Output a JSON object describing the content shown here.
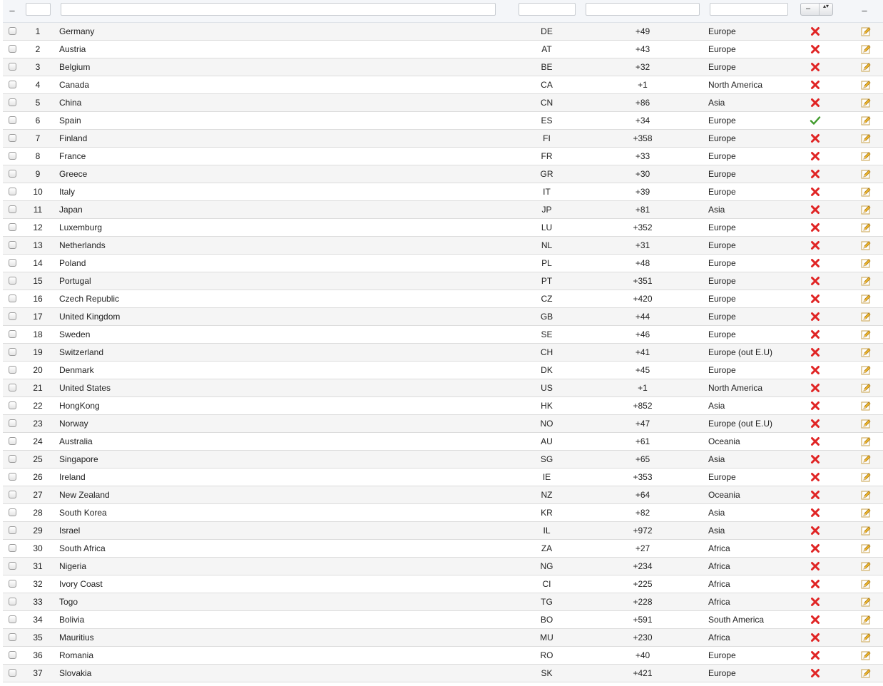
{
  "filters": {
    "select_dash": "–",
    "actions_dash": "–",
    "select_value": "–",
    "select_arrows": "▴▾",
    "id_placeholder": "",
    "name_placeholder": "",
    "code_placeholder": "",
    "prefix_placeholder": "",
    "region_placeholder": ""
  },
  "icons": {
    "inactive": "red-x-icon",
    "active": "green-check-icon",
    "edit": "pencil-icon"
  },
  "colors": {
    "inactive": "#e02424",
    "active": "#3f9a2a",
    "edit": "#e7a928",
    "row_alt": "#f5f5f5"
  },
  "rows": [
    {
      "id": "1",
      "name": "Germany",
      "code": "DE",
      "prefix": "+49",
      "region": "Europe",
      "active": false
    },
    {
      "id": "2",
      "name": "Austria",
      "code": "AT",
      "prefix": "+43",
      "region": "Europe",
      "active": false
    },
    {
      "id": "3",
      "name": "Belgium",
      "code": "BE",
      "prefix": "+32",
      "region": "Europe",
      "active": false
    },
    {
      "id": "4",
      "name": "Canada",
      "code": "CA",
      "prefix": "+1",
      "region": "North America",
      "active": false
    },
    {
      "id": "5",
      "name": "China",
      "code": "CN",
      "prefix": "+86",
      "region": "Asia",
      "active": false
    },
    {
      "id": "6",
      "name": "Spain",
      "code": "ES",
      "prefix": "+34",
      "region": "Europe",
      "active": true
    },
    {
      "id": "7",
      "name": "Finland",
      "code": "FI",
      "prefix": "+358",
      "region": "Europe",
      "active": false
    },
    {
      "id": "8",
      "name": "France",
      "code": "FR",
      "prefix": "+33",
      "region": "Europe",
      "active": false
    },
    {
      "id": "9",
      "name": "Greece",
      "code": "GR",
      "prefix": "+30",
      "region": "Europe",
      "active": false
    },
    {
      "id": "10",
      "name": "Italy",
      "code": "IT",
      "prefix": "+39",
      "region": "Europe",
      "active": false
    },
    {
      "id": "11",
      "name": "Japan",
      "code": "JP",
      "prefix": "+81",
      "region": "Asia",
      "active": false
    },
    {
      "id": "12",
      "name": "Luxemburg",
      "code": "LU",
      "prefix": "+352",
      "region": "Europe",
      "active": false
    },
    {
      "id": "13",
      "name": "Netherlands",
      "code": "NL",
      "prefix": "+31",
      "region": "Europe",
      "active": false
    },
    {
      "id": "14",
      "name": "Poland",
      "code": "PL",
      "prefix": "+48",
      "region": "Europe",
      "active": false
    },
    {
      "id": "15",
      "name": "Portugal",
      "code": "PT",
      "prefix": "+351",
      "region": "Europe",
      "active": false
    },
    {
      "id": "16",
      "name": "Czech Republic",
      "code": "CZ",
      "prefix": "+420",
      "region": "Europe",
      "active": false
    },
    {
      "id": "17",
      "name": "United Kingdom",
      "code": "GB",
      "prefix": "+44",
      "region": "Europe",
      "active": false
    },
    {
      "id": "18",
      "name": "Sweden",
      "code": "SE",
      "prefix": "+46",
      "region": "Europe",
      "active": false
    },
    {
      "id": "19",
      "name": "Switzerland",
      "code": "CH",
      "prefix": "+41",
      "region": "Europe (out E.U)",
      "active": false
    },
    {
      "id": "20",
      "name": "Denmark",
      "code": "DK",
      "prefix": "+45",
      "region": "Europe",
      "active": false
    },
    {
      "id": "21",
      "name": "United States",
      "code": "US",
      "prefix": "+1",
      "region": "North America",
      "active": false
    },
    {
      "id": "22",
      "name": "HongKong",
      "code": "HK",
      "prefix": "+852",
      "region": "Asia",
      "active": false
    },
    {
      "id": "23",
      "name": "Norway",
      "code": "NO",
      "prefix": "+47",
      "region": "Europe (out E.U)",
      "active": false
    },
    {
      "id": "24",
      "name": "Australia",
      "code": "AU",
      "prefix": "+61",
      "region": "Oceania",
      "active": false
    },
    {
      "id": "25",
      "name": "Singapore",
      "code": "SG",
      "prefix": "+65",
      "region": "Asia",
      "active": false
    },
    {
      "id": "26",
      "name": "Ireland",
      "code": "IE",
      "prefix": "+353",
      "region": "Europe",
      "active": false
    },
    {
      "id": "27",
      "name": "New Zealand",
      "code": "NZ",
      "prefix": "+64",
      "region": "Oceania",
      "active": false
    },
    {
      "id": "28",
      "name": "South Korea",
      "code": "KR",
      "prefix": "+82",
      "region": "Asia",
      "active": false
    },
    {
      "id": "29",
      "name": "Israel",
      "code": "IL",
      "prefix": "+972",
      "region": "Asia",
      "active": false
    },
    {
      "id": "30",
      "name": "South Africa",
      "code": "ZA",
      "prefix": "+27",
      "region": "Africa",
      "active": false
    },
    {
      "id": "31",
      "name": "Nigeria",
      "code": "NG",
      "prefix": "+234",
      "region": "Africa",
      "active": false
    },
    {
      "id": "32",
      "name": "Ivory Coast",
      "code": "CI",
      "prefix": "+225",
      "region": "Africa",
      "active": false
    },
    {
      "id": "33",
      "name": "Togo",
      "code": "TG",
      "prefix": "+228",
      "region": "Africa",
      "active": false
    },
    {
      "id": "34",
      "name": "Bolivia",
      "code": "BO",
      "prefix": "+591",
      "region": "South America",
      "active": false
    },
    {
      "id": "35",
      "name": "Mauritius",
      "code": "MU",
      "prefix": "+230",
      "region": "Africa",
      "active": false
    },
    {
      "id": "36",
      "name": "Romania",
      "code": "RO",
      "prefix": "+40",
      "region": "Europe",
      "active": false
    },
    {
      "id": "37",
      "name": "Slovakia",
      "code": "SK",
      "prefix": "+421",
      "region": "Europe",
      "active": false
    }
  ]
}
